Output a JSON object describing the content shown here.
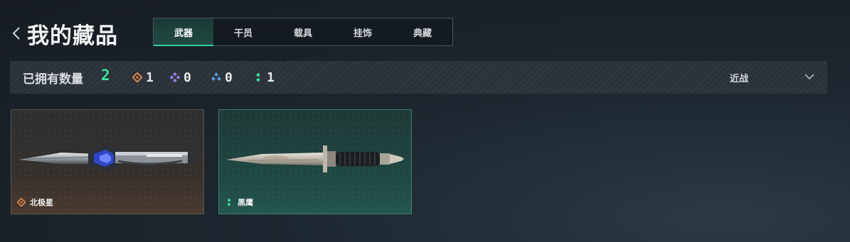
{
  "header": {
    "title": "我的藏品",
    "tabs": [
      {
        "label": "武器",
        "active": true
      },
      {
        "label": "干员",
        "active": false
      },
      {
        "label": "载具",
        "active": false
      },
      {
        "label": "挂饰",
        "active": false
      },
      {
        "label": "典藏",
        "active": false
      }
    ]
  },
  "stats": {
    "owned_label": "已拥有数量",
    "owned_count": "2",
    "rarities": [
      {
        "icon": "orange-diamond-icon",
        "color": "#e0874a",
        "count": "1"
      },
      {
        "icon": "purple-diamond-icon",
        "color": "#9a7ee0",
        "count": "0"
      },
      {
        "icon": "blue-triad-icon",
        "color": "#5b9be8",
        "count": "0"
      },
      {
        "icon": "green-dots-icon",
        "color": "#3ee39d",
        "count": "1"
      }
    ],
    "filter_label": "近战"
  },
  "items": [
    {
      "name": "北极星",
      "rarity_icon": "orange-diamond-icon",
      "rarity_color": "#e0874a"
    },
    {
      "name": "黑鹰",
      "rarity_icon": "green-dots-icon",
      "rarity_color": "#3ee39d"
    }
  ],
  "colors": {
    "accent_green": "#3ee39d",
    "active_tab_underline": "#2fd0a0"
  }
}
